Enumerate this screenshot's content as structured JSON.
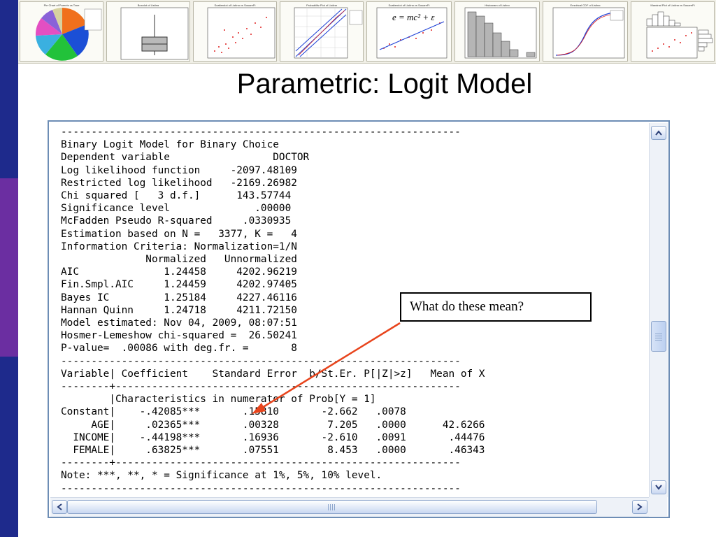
{
  "slide": {
    "title": "Parametric: Logit Model",
    "accent_colors": {
      "sidebar_blue": "#1e2a8c",
      "sidebar_purple": "#6b2ea1",
      "highlight": "#e4f5c3",
      "arrow": "#e8441c"
    }
  },
  "thumbnails": [
    {
      "title": "Pie Chart of Parents vs Type",
      "kind": "pie"
    },
    {
      "title": "Boxplot of Listing",
      "kind": "boxplot"
    },
    {
      "title": "Scatterplot of Listing vs SquareFt",
      "kind": "scatter"
    },
    {
      "title": "Probability Plot of Listing",
      "kind": "probability"
    },
    {
      "title": "Scatterplot of Listing vs SquareFt",
      "kind": "fit",
      "equation": "e = mc² + ε"
    },
    {
      "title": "Histogram of Listing",
      "kind": "histogram"
    },
    {
      "title": "Empirical CDF of Listing",
      "kind": "cdf"
    },
    {
      "title": "Marginal Plot of Listing vs SquareFt",
      "kind": "marginal"
    }
  ],
  "console": {
    "lines": [
      "------------------------------------------------------------------",
      "Binary Logit Model for Binary Choice",
      "Dependent variable                 DOCTOR",
      "Log likelihood function     -2097.48109",
      "Restricted log likelihood   -2169.26982",
      "Chi squared [   3 d.f.]      143.57744",
      "Significance level              .00000",
      "McFadden Pseudo R-squared     .0330935",
      "Estimation based on N =   3377, K =   4",
      "Information Criteria: Normalization=1/N",
      "              Normalized   Unnormalized",
      "AIC              1.24458     4202.96219",
      "Fin.Smpl.AIC     1.24459     4202.97405",
      "Bayes IC         1.25184     4227.46116",
      "Hannan Quinn     1.24718     4211.72150",
      "Model estimated: Nov 04, 2009, 08:07:51",
      "Hosmer-Lemeshow chi-squared =  26.50241",
      "P-value=  .00086 with deg.fr. =       8",
      "------------------------------------------------------------------",
      "Variable| Coefficient    Standard Error  b/St.Er. P[|Z|>z]   Mean of X",
      "--------+---------------------------------------------------------",
      "        |Characteristics in numerator of Prob[Y = 1]",
      "Constant|    -.42085***       .15810       -2.662   .0078",
      "     AGE|     .02365***       .00328        7.205   .0000      42.6266",
      "  INCOME|    -.44198***       .16936       -2.610   .0091       .44476",
      "  FEMALE|     .63825***       .07551        8.453   .0000       .46343",
      "--------+---------------------------------------------------------",
      "Note: ***, **, * = Significance at 1%, 5%, 10% level.",
      "------------------------------------------------------------------"
    ]
  },
  "callout": {
    "text": "What do these mean?"
  },
  "scrollbars": {
    "up_icon": "arrow-up-icon",
    "down_icon": "arrow-down-icon",
    "left_icon": "arrow-left-icon",
    "right_icon": "arrow-right-icon"
  }
}
